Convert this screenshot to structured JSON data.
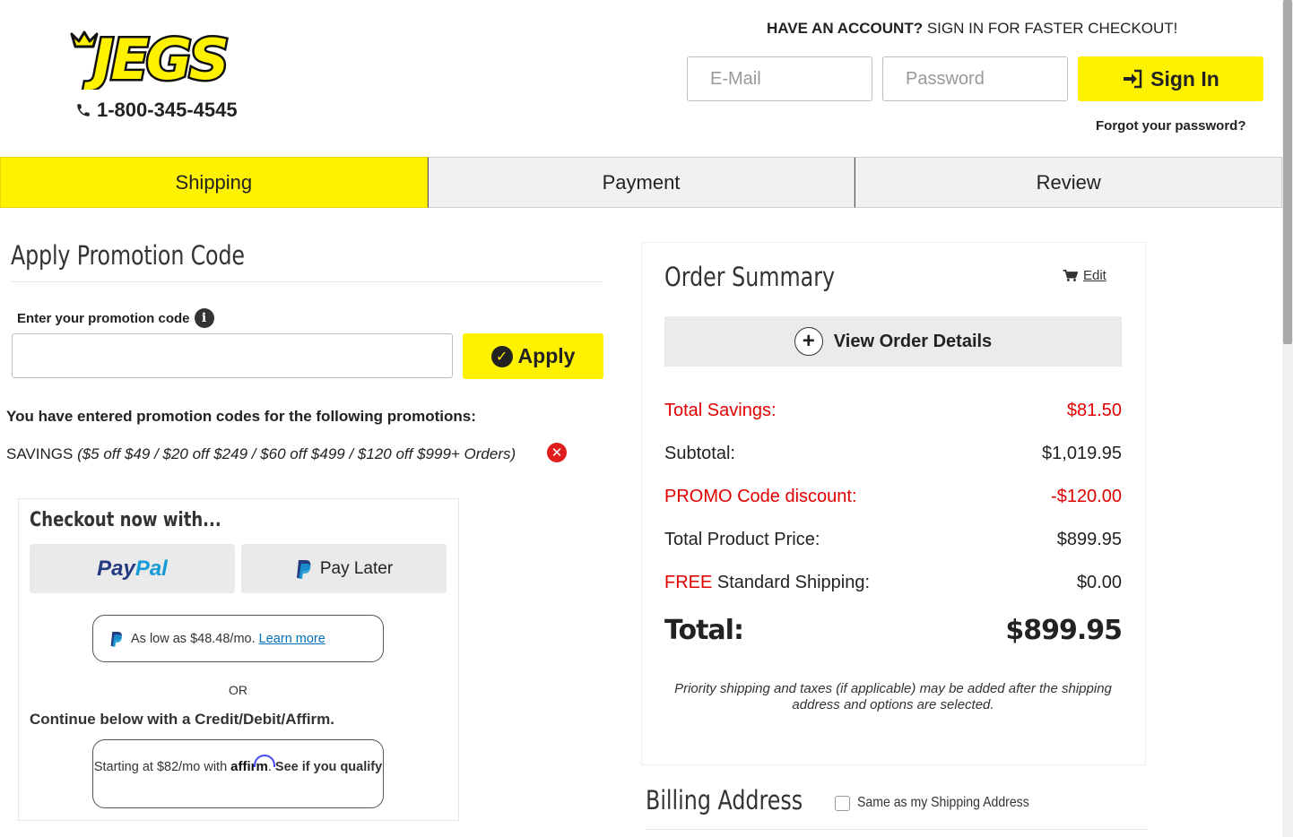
{
  "header": {
    "logo_text": "JEGS",
    "phone": "1-800-345-4545",
    "account_prompt_bold": "HAVE AN ACCOUNT?",
    "account_prompt_rest": " SIGN IN FOR FASTER CHECKOUT!",
    "email_placeholder": "E-Mail",
    "password_placeholder": "Password",
    "signin_label": "Sign In",
    "forgot_label": "Forgot your password?"
  },
  "steps": [
    {
      "label": "Shipping",
      "active": true
    },
    {
      "label": "Payment",
      "active": false
    },
    {
      "label": "Review",
      "active": false
    }
  ],
  "promo": {
    "title": "Apply Promotion Code",
    "input_label": "Enter your promotion code",
    "input_value": "",
    "apply_label": "Apply",
    "entered_msg": "You have entered promotion codes for the following promotions:",
    "code_name": "SAVINGS",
    "code_desc": "($5 off $49 / $20 off $249 / $60 off $499 / $120 off $999+ Orders)"
  },
  "checkout": {
    "title": "Checkout now with...",
    "paypal_part1": "Pay",
    "paypal_part2": "Pal",
    "paylater_label": "Pay Later",
    "as_low_text": "As low as $48.48/mo.",
    "learn_more": "Learn more",
    "or_text": "OR",
    "continue_text": "Continue below with a Credit/Debit/Affirm.",
    "affirm_prefix": "Starting at $82/mo with",
    "affirm_brand": "affirm",
    "affirm_cta": "See if you qualify"
  },
  "summary": {
    "title": "Order Summary",
    "edit_label": "Edit",
    "view_details_label": "View Order Details",
    "rows": {
      "savings_label": "Total Savings:",
      "savings_value": "$81.50",
      "subtotal_label": "Subtotal:",
      "subtotal_value": "$1,019.95",
      "promo_label": "PROMO Code discount:",
      "promo_value": "-$120.00",
      "product_label": "Total Product Price:",
      "product_value": "$899.95",
      "shipping_free": "FREE",
      "shipping_label": " Standard Shipping:",
      "shipping_value": "$0.00",
      "total_label": "Total:",
      "total_value": "$899.95"
    },
    "note": "Priority shipping and taxes (if applicable) may be added after the shipping address and options are selected."
  },
  "billing": {
    "title": "Billing Address",
    "same_as_label": "Same as my Shipping Address",
    "same_as_checked": false
  },
  "colors": {
    "brand_yellow": "#fff200",
    "savings_red": "#e00000",
    "paypal_dark": "#253b80",
    "paypal_light": "#179bd7"
  }
}
